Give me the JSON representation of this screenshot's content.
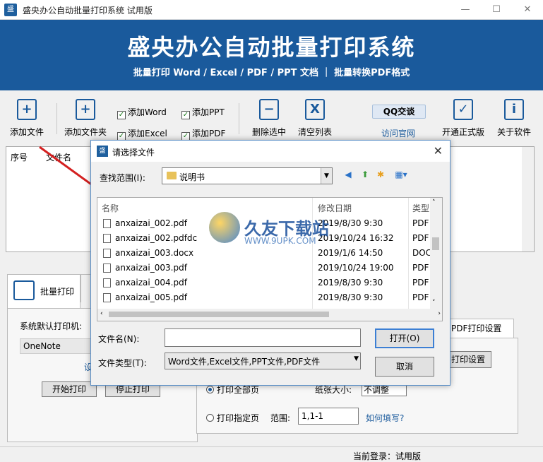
{
  "window": {
    "title": "盛央办公自动批量打印系统 试用版",
    "controls": [
      "—",
      "☐",
      "✕"
    ]
  },
  "banner": {
    "title": "盛央办公自动批量打印系统",
    "subtitle": "批量打印 Word / Excel / PDF / PPT 文档  ｜  批量转换PDF格式"
  },
  "toolbar": {
    "add_file": "添加文件",
    "add_folder": "添加文件夹",
    "add_word": "添加Word",
    "add_excel": "添加Excel",
    "add_ppt": "添加PPT",
    "add_pdf": "添加PDF",
    "delete_selected": "删除选中",
    "clear_list": "清空列表",
    "qq": "QQ交谈",
    "visit_site": "访问官网",
    "activate": "开通正式版",
    "about": "关于软件"
  },
  "filetable": {
    "columns": [
      "序号",
      "文件名"
    ]
  },
  "batch": {
    "tab_label": "批量打印",
    "default_printer_label": "系统默认打印机:",
    "printer_value": "OneNote",
    "settings_link": "设",
    "start_print": "开始打印",
    "stop_print": "停止打印"
  },
  "pdf": {
    "tab_label": "PDF打印设置",
    "print_settings_btn": "打印设置",
    "print_all": "打印全部页",
    "paper_size_label": "纸张大小:",
    "paper_size_value": "不调整",
    "print_range": "打印指定页",
    "range_label": "范围:",
    "range_value": "1,1-1",
    "how_to_fill": "如何填写?"
  },
  "status": {
    "login": "当前登录：试用版"
  },
  "dialog": {
    "title": "请选择文件",
    "lookin_label": "查找范围(I):",
    "lookin_value": "说明书",
    "col_name": "名称",
    "col_date": "修改日期",
    "col_type": "类型",
    "files": [
      {
        "name": "anxaizai_002.pdf",
        "date": "2019/8/30 9:30",
        "type": "PDF"
      },
      {
        "name": "anxaizai_002.pdfdc",
        "date": "2019/10/24 16:32",
        "type": "PDF"
      },
      {
        "name": "anxaizai_003.docx",
        "date": "2019/1/6 14:50",
        "type": "DOC"
      },
      {
        "name": "anxaizai_003.pdf",
        "date": "2019/10/24 19:00",
        "type": "PDF"
      },
      {
        "name": "anxaizai_004.pdf",
        "date": "2019/8/30 9:30",
        "type": "PDF"
      },
      {
        "name": "anxaizai_005.pdf",
        "date": "2019/8/30 9:30",
        "type": "PDF"
      }
    ],
    "filename_label": "文件名(N):",
    "filename_value": "",
    "filetype_label": "文件类型(T):",
    "filetype_value": "Word文件,Excel文件,PPT文件,PDF文件",
    "open_btn": "打开(O)",
    "cancel_btn": "取消"
  },
  "watermark": {
    "brand": "久友下载站",
    "url": "WWW.9UPK.COM"
  },
  "colors": {
    "brand_blue": "#1a5a9c",
    "arrow_red": "#d42020"
  }
}
